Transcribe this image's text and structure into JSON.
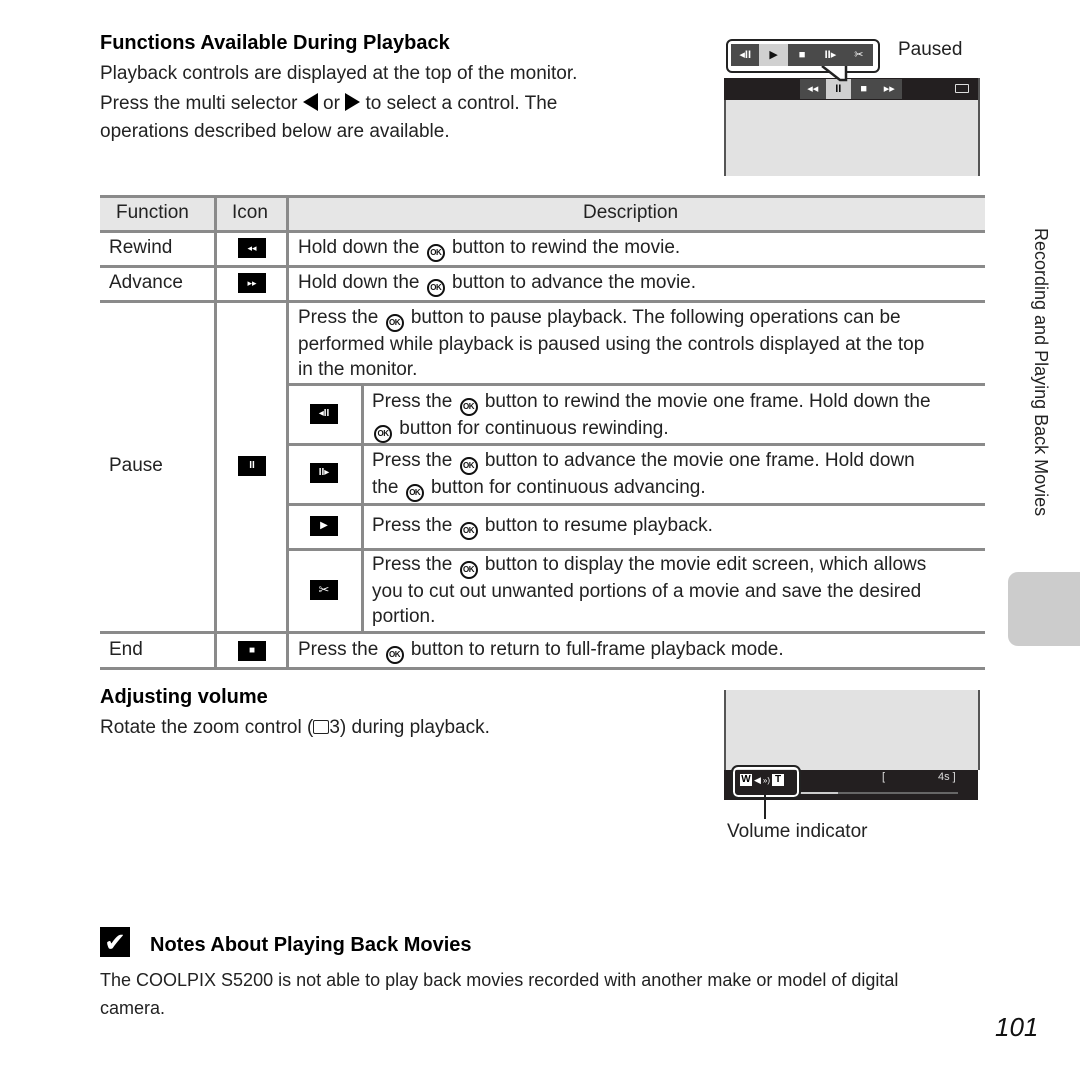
{
  "section": {
    "title": "Functions Available During Playback",
    "intro_line1": "Playback controls are displayed at the top of the monitor.",
    "intro_line2_a": "Press the multi selector",
    "intro_line2_or": "or",
    "intro_line2_b": "to select a control. The",
    "intro_line3": "operations described below are available."
  },
  "preview_top": {
    "label": "Paused",
    "paused_controls": [
      "◂II",
      "▶",
      "■",
      "II▸",
      "✂"
    ],
    "paused_selected": 1,
    "playback_controls": [
      "◂◂",
      "II",
      "■",
      "▸▸"
    ],
    "playback_selected": 1,
    "battery_icon": "battery-icon"
  },
  "table": {
    "headers": {
      "function": "Function",
      "icon": "Icon",
      "description": "Description"
    },
    "ok_label": "OK",
    "rows": {
      "rewind": {
        "function": "Rewind",
        "icon": "◂◂",
        "desc_a": "Hold down the",
        "desc_b": "button to rewind the movie."
      },
      "advance": {
        "function": "Advance",
        "icon": "▸▸",
        "desc_a": "Hold down the",
        "desc_b": "button to advance the movie."
      },
      "pause": {
        "function": "Pause",
        "icon": "II",
        "desc_line1_a": "Press the",
        "desc_line1_b": "button to pause playback. The following operations can be",
        "desc_line2": "performed while playback is paused using the controls displayed at the top",
        "desc_line3": "in the monitor.",
        "sub": {
          "frame_rewind": {
            "icon": "◂II",
            "line1_a": "Press the",
            "line1_b": "button to rewind the movie one frame. Hold down the",
            "line2_b": "button for continuous rewinding."
          },
          "frame_advance": {
            "icon": "II▸",
            "line1_a": "Press the",
            "line1_b": "button to advance the movie one frame. Hold down",
            "line2_a": "the",
            "line2_b": "button for continuous advancing."
          },
          "resume": {
            "icon": "▶",
            "line1_a": "Press the",
            "line1_b": "button to resume playback."
          },
          "edit": {
            "icon": "✂",
            "line1_a": "Press the",
            "line1_b": "button to display the movie edit screen, which allows",
            "line2": "you to cut out unwanted portions of a movie and save the desired",
            "line3": "portion."
          }
        }
      },
      "end": {
        "function": "End",
        "icon": "■",
        "desc_a": "Press the",
        "desc_b": "button to return to full-frame playback mode."
      }
    }
  },
  "volume": {
    "title": "Adjusting volume",
    "text_a": "Rotate the zoom control (",
    "book_icon": "book-icon",
    "text_ref": "3",
    "text_b": ") during playback.",
    "indicator_w": "W",
    "indicator_t": "T",
    "indicator_speaker": "◀",
    "indicator_waves": "»)",
    "time_open": "[",
    "time_value": "4s ]",
    "progress": 0.25,
    "callout_label": "Volume indicator"
  },
  "notes": {
    "check_icon": "✔",
    "title": "Notes About Playing Back Movies",
    "line1": "The COOLPIX S5200 is not able to play back movies recorded with another make or model of digital",
    "line2": "camera."
  },
  "sidebar": {
    "chapter": "Recording and Playing Back Movies"
  },
  "page_number": "101"
}
